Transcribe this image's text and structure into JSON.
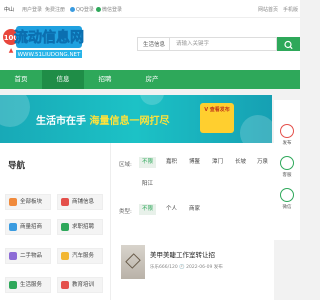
{
  "topbar": {
    "city": "中山",
    "login": "用户登录",
    "register": "免费注册",
    "qq_login": "QQ登录",
    "wechat_login": "微信登录",
    "home_link": "网站首页",
    "mobile_link": "手机版"
  },
  "header": {
    "logo_text": "流动信息网",
    "logo_sub": "WWW.51LIUDONG.NET",
    "city_select": "生活信息",
    "search_placeholder": "请输入关键字"
  },
  "nav": {
    "items": [
      "首页",
      "信息",
      "招聘",
      "房产"
    ]
  },
  "banner": {
    "text_part1": "生活市在手",
    "text_part2": "海量信息一网打尽",
    "tag": "V 查看发布"
  },
  "float": {
    "items": [
      "发布",
      "客服",
      "微信"
    ]
  },
  "sidebar": {
    "title": "导航",
    "categories": [
      "全部板块",
      "商铺信息",
      "商量招商",
      "求职招聘",
      "二手物品",
      "汽车服务",
      "生活服务",
      "教育培训"
    ]
  },
  "filters": {
    "area_label": "区域:",
    "area_options": [
      "不限",
      "嘉积",
      "博鳌",
      "潭门",
      "长坡",
      "万泉",
      "阳江"
    ],
    "type_label": "类型:",
    "type_options": [
      "不限",
      "个人",
      "商家"
    ]
  },
  "listing": {
    "title": "美甲美睫工作室转让招",
    "meta": "乐乐666/120 🕐 2022-06-09 发布"
  },
  "colors": {
    "accent": "#2ea85a",
    "nav_active": "#1f8d47"
  }
}
